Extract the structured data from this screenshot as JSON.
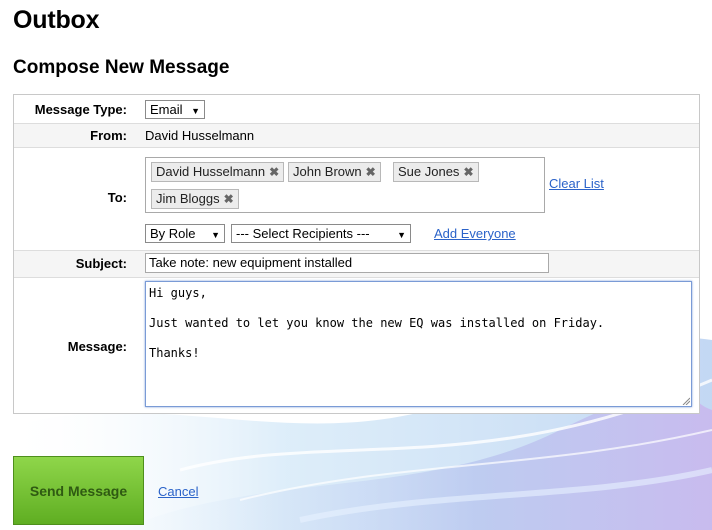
{
  "page": {
    "title": "Outbox",
    "subtitle": "Compose New Message"
  },
  "form": {
    "message_type": {
      "label": "Message Type:",
      "value": "Email"
    },
    "from": {
      "label": "From:",
      "value": "David Husselmann"
    },
    "to": {
      "label": "To:",
      "recipients": [
        "David Husselmann",
        "John Brown",
        "Sue Jones",
        "Jim Bloggs"
      ],
      "remove_glyph": "✖",
      "clear_list": "Clear List",
      "group_select": "By Role",
      "recipient_select": "--- Select Recipients ---",
      "add_everyone": "Add Everyone"
    },
    "subject": {
      "label": "Subject:",
      "value": "Take note: new equipment installed"
    },
    "message": {
      "label": "Message:",
      "lines": [
        "Hi guys,",
        "",
        "Just wanted to let you know the new EQ was installed on Friday.",
        "",
        "Thanks!"
      ]
    }
  },
  "actions": {
    "send": "Send Message",
    "cancel": "Cancel"
  },
  "icons": {
    "dropdown": "chevron-down-icon",
    "remove": "close-icon",
    "resize": "resize-grip-icon"
  },
  "colors": {
    "link": "#2b63c9",
    "send_button": "#6fbf2c",
    "textarea_focus": "#7a9bd6"
  }
}
